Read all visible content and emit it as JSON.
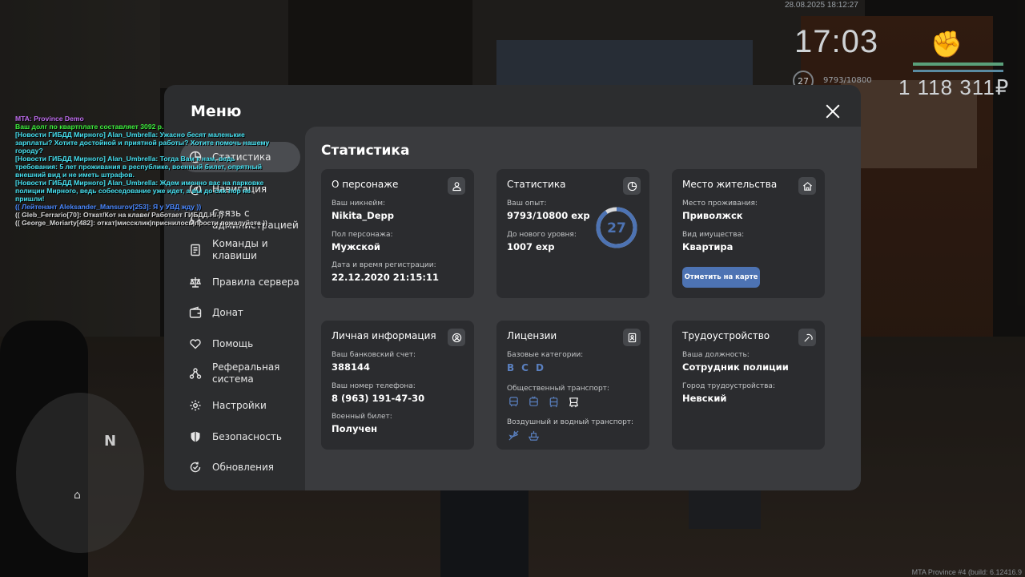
{
  "hud": {
    "date": "28.08.2025 18:12:27",
    "time": "17:03",
    "level": "27",
    "exp": "9793/10800",
    "money": "1 118 311₽"
  },
  "build": "MTA Province #4 (build: 6.12416.9",
  "chat": [
    {
      "text": "MTA: Province Demo",
      "color": "#c06ef0"
    },
    {
      "text": "Ваш долг по квартплате составляет 3092 р.",
      "color": "#3ef03e"
    },
    {
      "text": "[Новости ГИБДД Мирного] Alan_Umbrella: Ужасно бесят маленькие зарплаты? Хотите достойной и приятной работы? Хотите помочь нашему городу?",
      "color": "#46e0f0"
    },
    {
      "text": "[Новости ГИБДД Мирного] Alan_Umbrella: Тогда Вам к нам, ведь требования: 5 лет проживания в республике, военный билет, опрятный внешний вид и не иметь штрафов.",
      "color": "#46e0f0"
    },
    {
      "text": "[Новости ГИБДД Мирного] Alan_Umbrella: Ждем именно вас на парковке полиции Мирного, ведь собеседование уже идет, а вы до сих пор не пришли!",
      "color": "#46e0f0"
    },
    {
      "text": "(( Лейтенант Aleksander_Mansurov[253]: Я у УВД жду ))",
      "color": "#4a88ff"
    },
    {
      "text": "(( Gleb_Ferrario[70]: Откат/Кот на клаве/ Работает ГИБДД.Н/ ))",
      "color": "#d8d8d8"
    },
    {
      "text": "(( George_Moriarty[482]: откат|миссклик|приснилось|прости пожалуйста ))",
      "color": "#d8d8d8"
    }
  ],
  "minimap": {
    "north": "N"
  },
  "menu": {
    "title": "Меню",
    "nav": [
      {
        "label": "Статистика",
        "icon": "chart-icon"
      },
      {
        "label": "Навигация",
        "icon": "compass-icon"
      },
      {
        "label": "Связь с администрацией",
        "icon": "headset-icon"
      },
      {
        "label": "Команды и клавиши",
        "icon": "document-icon"
      },
      {
        "label": "Правила сервера",
        "icon": "scales-icon"
      },
      {
        "label": "Донат",
        "icon": "wallet-icon"
      },
      {
        "label": "Помощь",
        "icon": "heart-hand-icon"
      },
      {
        "label": "Реферальная система",
        "icon": "network-icon"
      },
      {
        "label": "Настройки",
        "icon": "gear-icon"
      },
      {
        "label": "Безопасность",
        "icon": "shield-icon"
      },
      {
        "label": "Обновления",
        "icon": "update-icon"
      }
    ]
  },
  "stats": {
    "title": "Статистика",
    "character": {
      "title": "О персонаже",
      "nickname_label": "Ваш никнейм:",
      "nickname": "Nikita_Depp",
      "gender_label": "Пол персонажа:",
      "gender": "Мужской",
      "reg_label": "Дата и время регистрации:",
      "reg": "22.12.2020 21:15:11"
    },
    "statistics": {
      "title": "Статистика",
      "exp_label": "Ваш опыт:",
      "exp": "9793/10800 exp",
      "next_label": "До нового уровня:",
      "next": "1007 exp",
      "level": "27",
      "progress": 0.9068
    },
    "residence": {
      "title": "Место жительства",
      "place_label": "Место проживания:",
      "place": "Приволжск",
      "property_label": "Вид имущества:",
      "property": "Квартира",
      "map_button": "Отметить на карте"
    },
    "personal": {
      "title": "Личная информация",
      "bank_label": "Ваш банковский счет:",
      "bank": "388144",
      "phone_label": "Ваш номер телефона:",
      "phone": "8 (963) 191-47-30",
      "military_label": "Военный билет:",
      "military": "Получен"
    },
    "licenses": {
      "title": "Лицензии",
      "basic_label": "Базовые категории:",
      "categories": [
        "B",
        "C",
        "D"
      ],
      "public_label": "Общественный транспорт:",
      "air_label": "Воздушный и водный транспорт:"
    },
    "employment": {
      "title": "Трудоустройство",
      "position_label": "Ваша должность:",
      "position": "Сотрудник полиции",
      "city_label": "Город трудоустройства:",
      "city": "Невский"
    }
  },
  "colors": {
    "accent": "#4d73b3",
    "ring": "#4d73b3",
    "card": "#2b2c2f",
    "panel": "#3a3b3e"
  }
}
